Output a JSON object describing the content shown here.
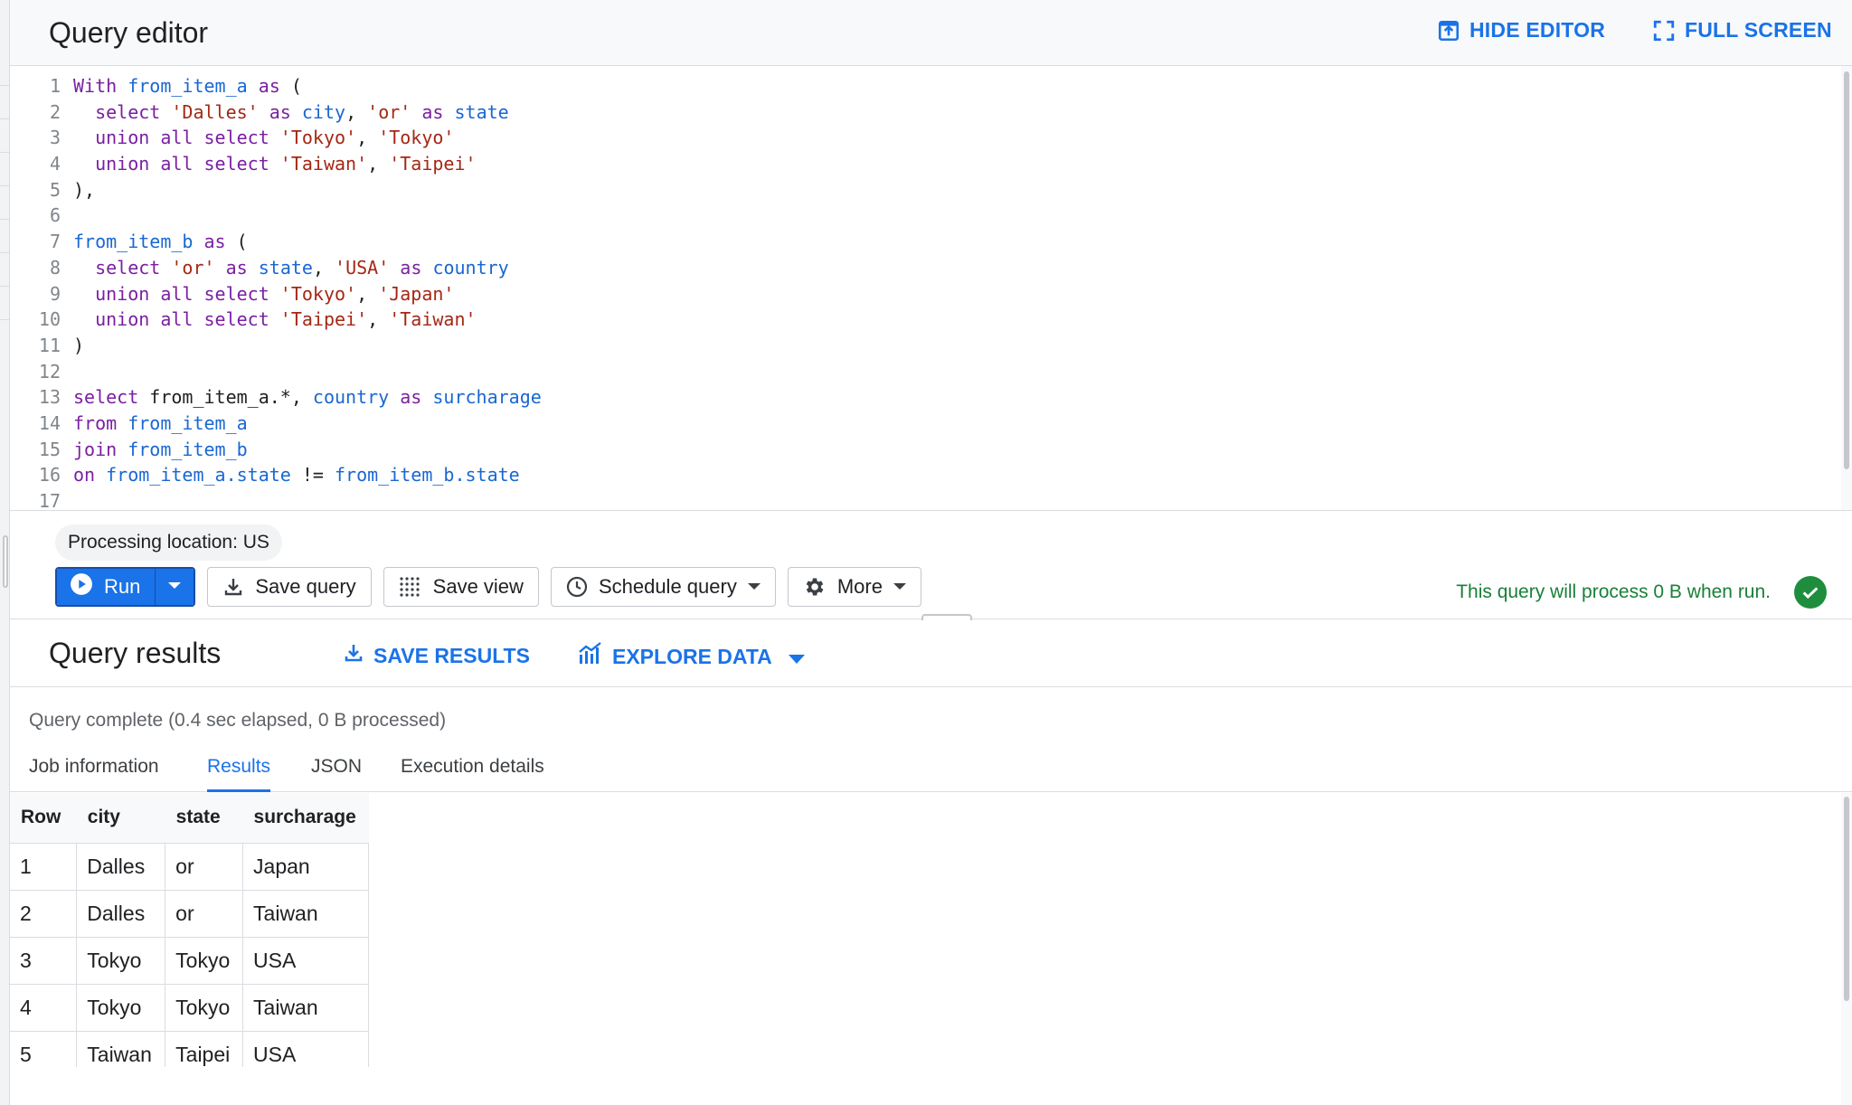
{
  "editor": {
    "title": "Query editor",
    "hide_editor": "HIDE EDITOR",
    "full_screen": "FULL SCREEN",
    "lines": [
      {
        "n": "1",
        "tokens": [
          [
            "kw",
            "With "
          ],
          [
            "id",
            "from_item_a"
          ],
          [
            "kw",
            " as"
          ],
          [
            "txt",
            " ("
          ]
        ]
      },
      {
        "n": "2",
        "tokens": [
          [
            "txt",
            "  "
          ],
          [
            "kw",
            "select "
          ],
          [
            "str",
            "'Dalles'"
          ],
          [
            "kw",
            " as "
          ],
          [
            "id",
            "city"
          ],
          [
            "txt",
            ", "
          ],
          [
            "str",
            "'or'"
          ],
          [
            "kw",
            " as "
          ],
          [
            "id",
            "state"
          ]
        ]
      },
      {
        "n": "3",
        "tokens": [
          [
            "txt",
            "  "
          ],
          [
            "kw",
            "union all select "
          ],
          [
            "str",
            "'Tokyo'"
          ],
          [
            "txt",
            ", "
          ],
          [
            "str",
            "'Tokyo'"
          ]
        ]
      },
      {
        "n": "4",
        "tokens": [
          [
            "txt",
            "  "
          ],
          [
            "kw",
            "union all select "
          ],
          [
            "str",
            "'Taiwan'"
          ],
          [
            "txt",
            ", "
          ],
          [
            "str",
            "'Taipei'"
          ]
        ]
      },
      {
        "n": "5",
        "tokens": [
          [
            "txt",
            "),"
          ]
        ]
      },
      {
        "n": "6",
        "tokens": []
      },
      {
        "n": "7",
        "tokens": [
          [
            "id",
            "from_item_b"
          ],
          [
            "kw",
            " as"
          ],
          [
            "txt",
            " ("
          ]
        ]
      },
      {
        "n": "8",
        "tokens": [
          [
            "txt",
            "  "
          ],
          [
            "kw",
            "select "
          ],
          [
            "str",
            "'or'"
          ],
          [
            "kw",
            " as "
          ],
          [
            "id",
            "state"
          ],
          [
            "txt",
            ", "
          ],
          [
            "str",
            "'USA'"
          ],
          [
            "kw",
            " as "
          ],
          [
            "id",
            "country"
          ]
        ]
      },
      {
        "n": "9",
        "tokens": [
          [
            "txt",
            "  "
          ],
          [
            "kw",
            "union all select "
          ],
          [
            "str",
            "'Tokyo'"
          ],
          [
            "txt",
            ", "
          ],
          [
            "str",
            "'Japan'"
          ]
        ]
      },
      {
        "n": "10",
        "tokens": [
          [
            "txt",
            "  "
          ],
          [
            "kw",
            "union all select "
          ],
          [
            "str",
            "'Taipei'"
          ],
          [
            "txt",
            ", "
          ],
          [
            "str",
            "'Taiwan'"
          ]
        ]
      },
      {
        "n": "11",
        "tokens": [
          [
            "txt",
            ")"
          ]
        ]
      },
      {
        "n": "12",
        "tokens": []
      },
      {
        "n": "13",
        "tokens": [
          [
            "kw",
            "select "
          ],
          [
            "txt",
            "from_item_a.*, "
          ],
          [
            "id",
            "country"
          ],
          [
            "kw",
            " as "
          ],
          [
            "id",
            "surcharage"
          ]
        ]
      },
      {
        "n": "14",
        "tokens": [
          [
            "kw",
            "from "
          ],
          [
            "id",
            "from_item_a"
          ]
        ]
      },
      {
        "n": "15",
        "tokens": [
          [
            "kw",
            "join "
          ],
          [
            "id",
            "from_item_b"
          ]
        ]
      },
      {
        "n": "16",
        "tokens": [
          [
            "kw",
            "on "
          ],
          [
            "id",
            "from_item_a.state"
          ],
          [
            "txt",
            " != "
          ],
          [
            "id",
            "from_item_b.state"
          ]
        ]
      },
      {
        "n": "17",
        "tokens": []
      }
    ]
  },
  "toolbar": {
    "processing_location": "Processing location: US",
    "run_label": "Run",
    "save_query_label": "Save query",
    "save_view_label": "Save view",
    "schedule_query_label": "Schedule query",
    "more_label": "More",
    "validator_message": "This query will process 0 B when run."
  },
  "results": {
    "title": "Query results",
    "save_results": "SAVE RESULTS",
    "explore_data": "EXPLORE DATA",
    "status": "Query complete (0.4 sec elapsed, 0 B processed)",
    "tabs": [
      "Job information",
      "Results",
      "JSON",
      "Execution details"
    ],
    "active_tab": "Results",
    "columns": [
      "Row",
      "city",
      "state",
      "surcharage"
    ],
    "rows": [
      [
        "1",
        "Dalles",
        "or",
        "Japan"
      ],
      [
        "2",
        "Dalles",
        "or",
        "Taiwan"
      ],
      [
        "3",
        "Tokyo",
        "Tokyo",
        "USA"
      ],
      [
        "4",
        "Tokyo",
        "Tokyo",
        "Taiwan"
      ],
      [
        "5",
        "Taiwan",
        "Taipei",
        "USA"
      ]
    ]
  },
  "colors": {
    "accent": "#1a73e8",
    "keyword": "#7b1fa2",
    "identifier": "#1967d2",
    "string": "#a52714",
    "success": "#188038"
  },
  "icons": {
    "hide_editor": "panel-collapse-icon",
    "full_screen": "fullscreen-icon",
    "run": "play-circle-icon",
    "save_query": "download-icon",
    "save_view": "grid-dots-icon",
    "schedule_query": "clock-icon",
    "more": "gear-icon",
    "validator": "check-circle-icon",
    "save_results": "download-icon",
    "explore_data": "chart-icon"
  }
}
